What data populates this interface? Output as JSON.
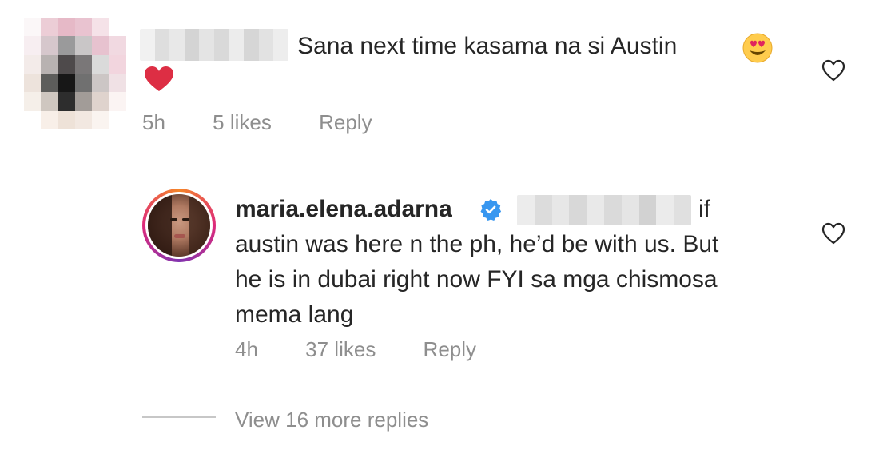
{
  "comment": {
    "text": "Sana next time kasama na  si Austin",
    "heart_emoji": "❤️",
    "time": "5h",
    "likes": "5 likes",
    "reply_label": "Reply"
  },
  "reply": {
    "username": "maria.elena.adarna",
    "text_line1_suffix": "if",
    "text_lines": [
      "austin was here n the ph, he’d be with us. But",
      "he is in dubai right now FYI sa mga chismosa",
      "mema lang"
    ],
    "time": "4h",
    "likes": "37 likes",
    "reply_label": "Reply"
  },
  "view_more": "View 16 more replies",
  "colors": {
    "text": "#262626",
    "meta": "#8e8e8e",
    "verified": "#3897f0",
    "heart": "#ed4956"
  }
}
